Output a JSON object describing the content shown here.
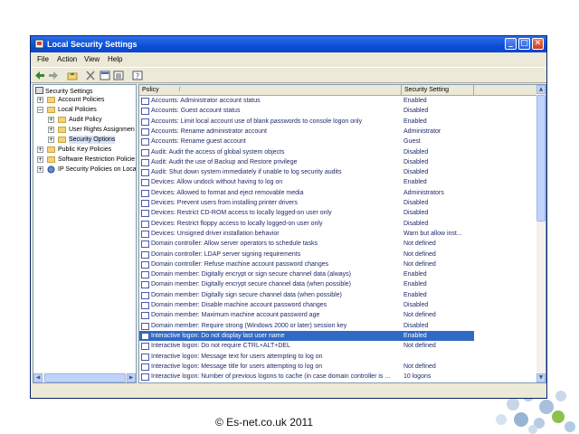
{
  "window": {
    "title": "Local Security Settings",
    "controls": {
      "minimize": "_",
      "maximize": "□",
      "close": "✕"
    }
  },
  "menu": [
    "File",
    "Action",
    "View",
    "Help"
  ],
  "tree": {
    "root": "Security Settings",
    "items": [
      {
        "label": "Account Policies"
      },
      {
        "label": "Local Policies"
      },
      {
        "label": "Audit Policy"
      },
      {
        "label": "User Rights Assignmen"
      },
      {
        "label": "Security Options"
      },
      {
        "label": "Public Key Policies"
      },
      {
        "label": "Software Restriction Policie"
      },
      {
        "label": "IP Security Policies on Loca"
      }
    ]
  },
  "list": {
    "columns": {
      "policy": "Policy",
      "setting": "Security Setting",
      "sort_indicator": "/"
    },
    "rows": [
      {
        "policy": "Accounts: Administrator account status",
        "setting": "Enabled"
      },
      {
        "policy": "Accounts: Guest account status",
        "setting": "Disabled"
      },
      {
        "policy": "Accounts: Limit local account use of blank passwords to console logon only",
        "setting": "Enabled"
      },
      {
        "policy": "Accounts: Rename administrator account",
        "setting": "Administrator"
      },
      {
        "policy": "Accounts: Rename guest account",
        "setting": "Guest"
      },
      {
        "policy": "Audit: Audit the access of global system objects",
        "setting": "Disabled"
      },
      {
        "policy": "Audit: Audit the use of Backup and Restore privilege",
        "setting": "Disabled"
      },
      {
        "policy": "Audit: Shut down system immediately if unable to log security audits",
        "setting": "Disabled"
      },
      {
        "policy": "Devices: Allow undock without having to log on",
        "setting": "Enabled"
      },
      {
        "policy": "Devices: Allowed to format and eject removable media",
        "setting": "Administrators"
      },
      {
        "policy": "Devices: Prevent users from installing printer drivers",
        "setting": "Disabled"
      },
      {
        "policy": "Devices: Restrict CD-ROM access to locally logged-on user only",
        "setting": "Disabled"
      },
      {
        "policy": "Devices: Restrict floppy access to locally logged-on user only",
        "setting": "Disabled"
      },
      {
        "policy": "Devices: Unsigned driver installation behavior",
        "setting": "Warn but allow inst..."
      },
      {
        "policy": "Domain controller: Allow server operators to schedule tasks",
        "setting": "Not defined"
      },
      {
        "policy": "Domain controller: LDAP server signing requirements",
        "setting": "Not defined"
      },
      {
        "policy": "Domain controller: Refuse machine account password changes",
        "setting": "Not defined"
      },
      {
        "policy": "Domain member: Digitally encrypt or sign secure channel data (always)",
        "setting": "Enabled"
      },
      {
        "policy": "Domain member: Digitally encrypt secure channel data (when possible)",
        "setting": "Enabled"
      },
      {
        "policy": "Domain member: Digitally sign secure channel data (when possible)",
        "setting": "Enabled"
      },
      {
        "policy": "Domain member: Disable machine account password changes",
        "setting": "Disabled"
      },
      {
        "policy": "Domain member: Maximum machine account password age",
        "setting": "Not defined"
      },
      {
        "policy": "Domain member: Require strong (Windows 2000 or later) session key",
        "setting": "Disabled"
      },
      {
        "policy": "Interactive logon: Do not display last user name",
        "setting": "Enabled"
      },
      {
        "policy": "Interactive logon: Do not require CTRL+ALT+DEL",
        "setting": "Not defined"
      },
      {
        "policy": "Interactive logon: Message text for users attempting to log on",
        "setting": ""
      },
      {
        "policy": "Interactive logon: Message title for users attempting to log on",
        "setting": "Not defined"
      },
      {
        "policy": "Interactive logon: Number of previous logons to cache (in case domain controller is ...",
        "setting": "10 logons"
      }
    ]
  },
  "footer": {
    "copyright": "© Es-net.co.uk 2011"
  }
}
